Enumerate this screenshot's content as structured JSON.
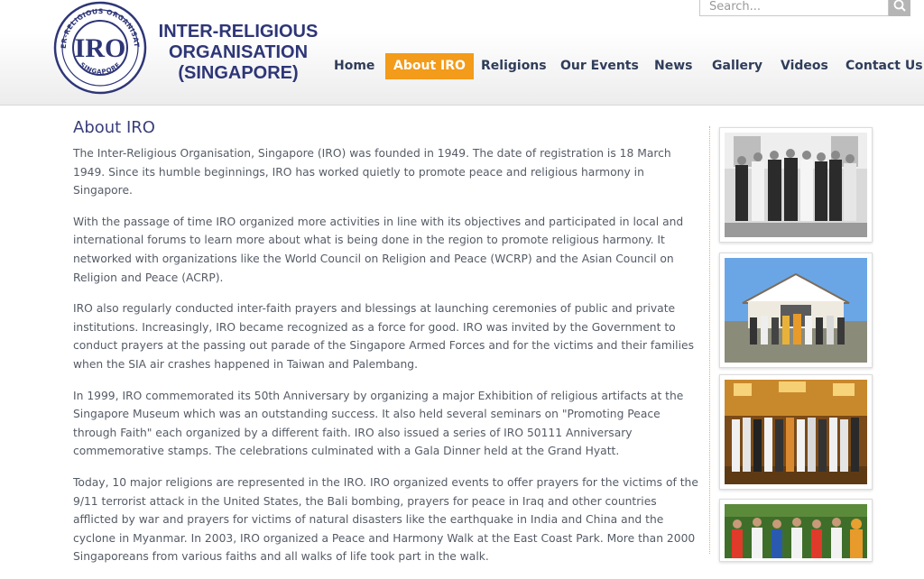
{
  "header": {
    "org_name_line1": "INTER-RELIGIOUS",
    "org_name_line2": "ORGANISATION",
    "org_name_line3": "(SINGAPORE)",
    "logo": {
      "monogram": "IRO",
      "ring_text_top": "INTER-RELIGIOUS ORGANISATION",
      "ring_text_bottom": "SINGAPORE",
      "color": "#2e3677"
    }
  },
  "search": {
    "placeholder": "Search...",
    "button_icon": "search-icon"
  },
  "nav": {
    "items": [
      {
        "label": "Home"
      },
      {
        "label": "About IRO",
        "active": true
      },
      {
        "label": "Religions"
      },
      {
        "label": "Our Events"
      },
      {
        "label": "News"
      },
      {
        "label": "Gallery"
      },
      {
        "label": "Videos"
      },
      {
        "label": "Contact Us"
      }
    ],
    "active_color": "#f39b1a"
  },
  "main": {
    "title": "About IRO",
    "paragraphs": [
      "The Inter-Religious Organisation, Singapore (IRO) was founded in 1949. The date of registration is 18 March 1949. Since its humble beginnings, IRO has worked quietly to promote peace and religious harmony in Singapore.",
      "With the passage of time IRO organized more activities in line with its objectives and participated in local and international forums to learn more about what is being done in the region to promote religious harmony. It networked with organizations like the World Council on Religion and Peace (WCRP) and the Asian Council on Religion and Peace (ACRP).",
      "IRO also regularly conducted inter-faith prayers and blessings at launching ceremonies of public and private institutions. Increasingly, IRO became recognized as a force for good. IRO was invited by the Government to conduct prayers at the passing out parade of the Singapore Armed Forces and for the victims and their families when the SIA air crashes happened in Taiwan and Palembang.",
      "In 1999, IRO commemorated its 50th Anniversary by organizing a major Exhibition of religious artifacts at the Singapore Museum which was an outstanding success. It also held several seminars on \"Promoting Peace through Faith\" each organized by a different faith. IRO also issued a series of IRO 50111 Anniversary commemorative stamps. The celebrations culminated with a Gala Dinner held at the Grand Hyatt.",
      "Today, 10 major religions are represented in the IRO. IRO organized events to offer prayers for the victims of the 9/11 terrorist attack in the United States, the Bali bombing, prayers for peace in Iraq and other countries afflicted by war and prayers for victims of natural disasters like the earthquake in India and China and the cyclone in Myanmar. In 2003, IRO organized a Peace and Harmony Walk at the East Coast Park. More than 2000 Singaporeans from various faiths and all walks of life took part in the walk."
    ]
  },
  "sidebar": {
    "photos": [
      {
        "name": "group-photo-black-white"
      },
      {
        "name": "group-photo-outdoor"
      },
      {
        "name": "group-photo-hall"
      },
      {
        "name": "group-photo-walk"
      }
    ]
  }
}
